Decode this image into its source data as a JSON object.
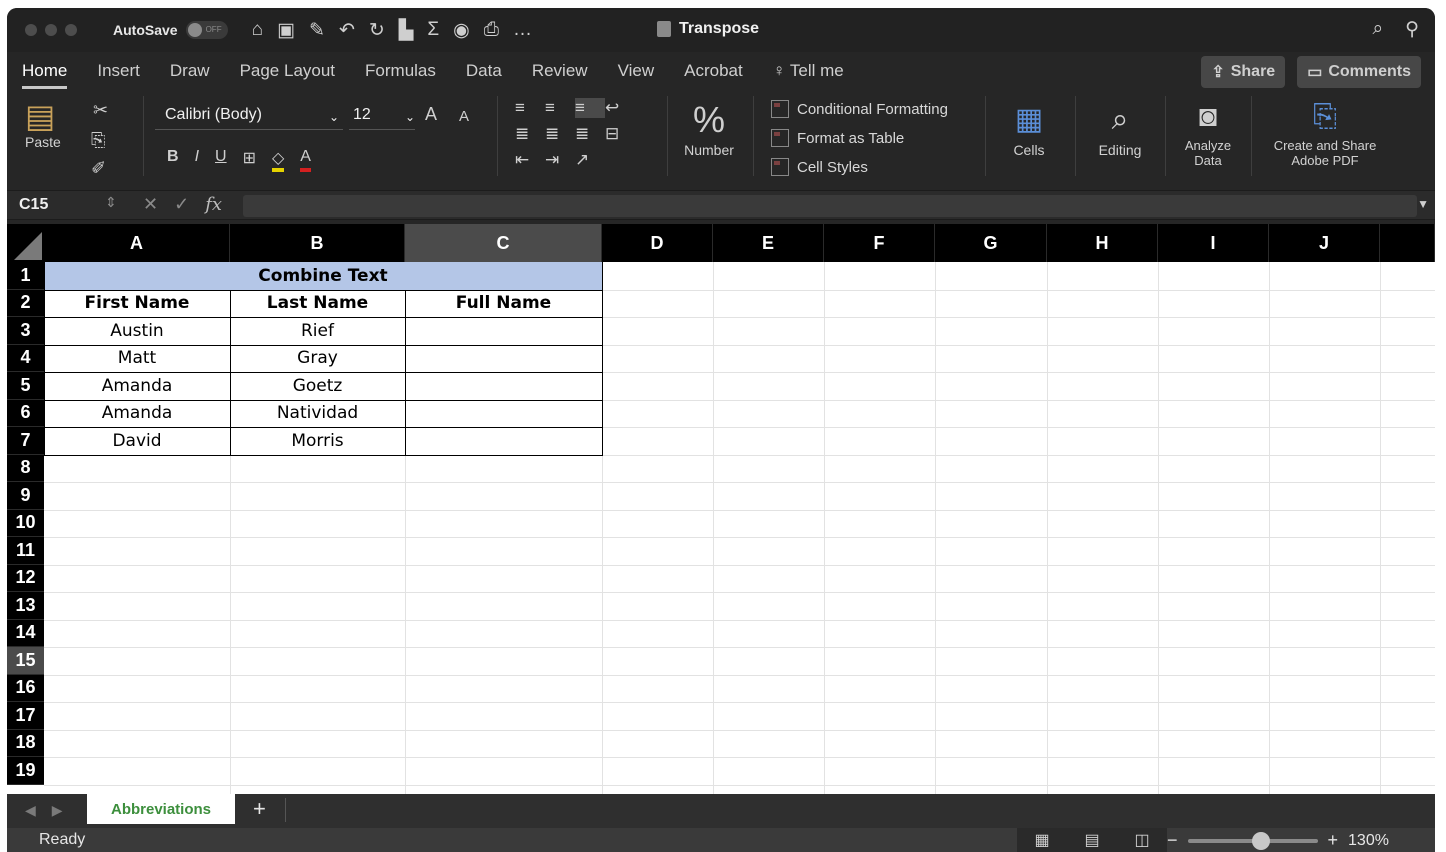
{
  "titlebar": {
    "autosave_label": "AutoSave",
    "autosave_state": "OFF",
    "doc_title": "Transpose"
  },
  "tabs": [
    "Home",
    "Insert",
    "Draw",
    "Page Layout",
    "Formulas",
    "Data",
    "Review",
    "View",
    "Acrobat",
    "Tell me"
  ],
  "tab_buttons": {
    "share": "Share",
    "comments": "Comments"
  },
  "ribbon": {
    "paste": "Paste",
    "font_name": "Calibri (Body)",
    "font_size": "12",
    "number": "Number",
    "conditional_formatting": "Conditional Formatting",
    "format_as_table": "Format as Table",
    "cell_styles": "Cell Styles",
    "cells": "Cells",
    "editing": "Editing",
    "analyze_data_1": "Analyze",
    "analyze_data_2": "Data",
    "create_share_1": "Create and Share",
    "create_share_2": "Adobe PDF"
  },
  "formula_bar": {
    "name_box": "C15",
    "fx": "fx",
    "value": ""
  },
  "columns": [
    "A",
    "B",
    "C",
    "D",
    "E",
    "F",
    "G",
    "H",
    "I",
    "J"
  ],
  "rows": [
    "1",
    "2",
    "3",
    "4",
    "5",
    "6",
    "7",
    "8",
    "9",
    "10",
    "11",
    "12",
    "13",
    "14",
    "15",
    "16",
    "17",
    "18",
    "19"
  ],
  "selected_cell": {
    "column": "C",
    "row": "15"
  },
  "sheet": {
    "title": "Combine Text",
    "headers": [
      "First Name",
      "Last Name",
      "Full Name"
    ],
    "data": [
      [
        "Austin",
        "Rief",
        ""
      ],
      [
        "Matt",
        "Gray",
        ""
      ],
      [
        "Amanda",
        "Goetz",
        ""
      ],
      [
        "Amanda",
        "Natividad",
        ""
      ],
      [
        "David",
        "Morris",
        ""
      ]
    ]
  },
  "sheet_tabs": [
    "Abbreviations"
  ],
  "status": {
    "ready": "Ready",
    "zoom": "130%"
  },
  "colors": {
    "title_fill": "#b4c6e7",
    "active_tab_text": "#3d8f3d"
  }
}
